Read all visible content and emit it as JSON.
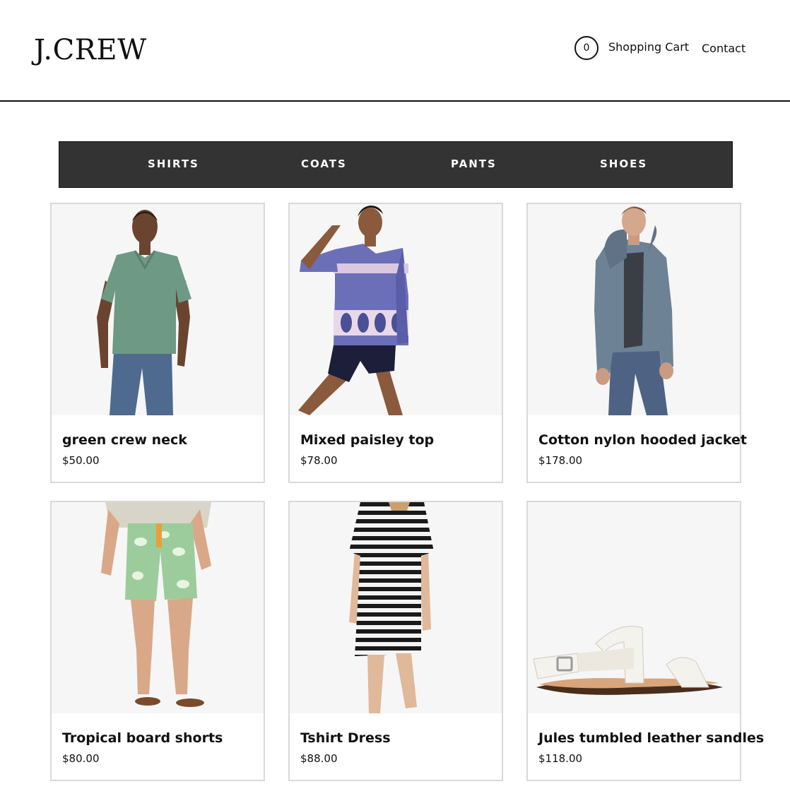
{
  "header": {
    "logo": "J.CREW",
    "cart_count": "0",
    "cart_label": "Shopping Cart",
    "contact_label": "Contact"
  },
  "nav": {
    "items": [
      "SHIRTS",
      "COATS",
      "PANTS",
      "SHOES"
    ]
  },
  "products": [
    {
      "name": "green crew neck",
      "price": "$50.00",
      "image_icon": "man-green-tshirt-photo"
    },
    {
      "name": "Mixed paisley top",
      "price": "$78.00",
      "image_icon": "woman-paisley-top-photo"
    },
    {
      "name": "Cotton nylon hooded jacket",
      "price": "$178.00",
      "image_icon": "man-hooded-jacket-photo"
    },
    {
      "name": "Tropical board shorts",
      "price": "$80.00",
      "image_icon": "floral-board-shorts-photo"
    },
    {
      "name": "Tshirt Dress",
      "price": "$88.00",
      "image_icon": "striped-tshirt-dress-photo"
    },
    {
      "name": "Jules tumbled leather sandles",
      "price": "$118.00",
      "image_icon": "white-leather-sandal-photo"
    }
  ],
  "colors": {
    "nav_background": "#333333",
    "card_border": "#d9d9d9",
    "image_background": "#f6f6f6"
  }
}
